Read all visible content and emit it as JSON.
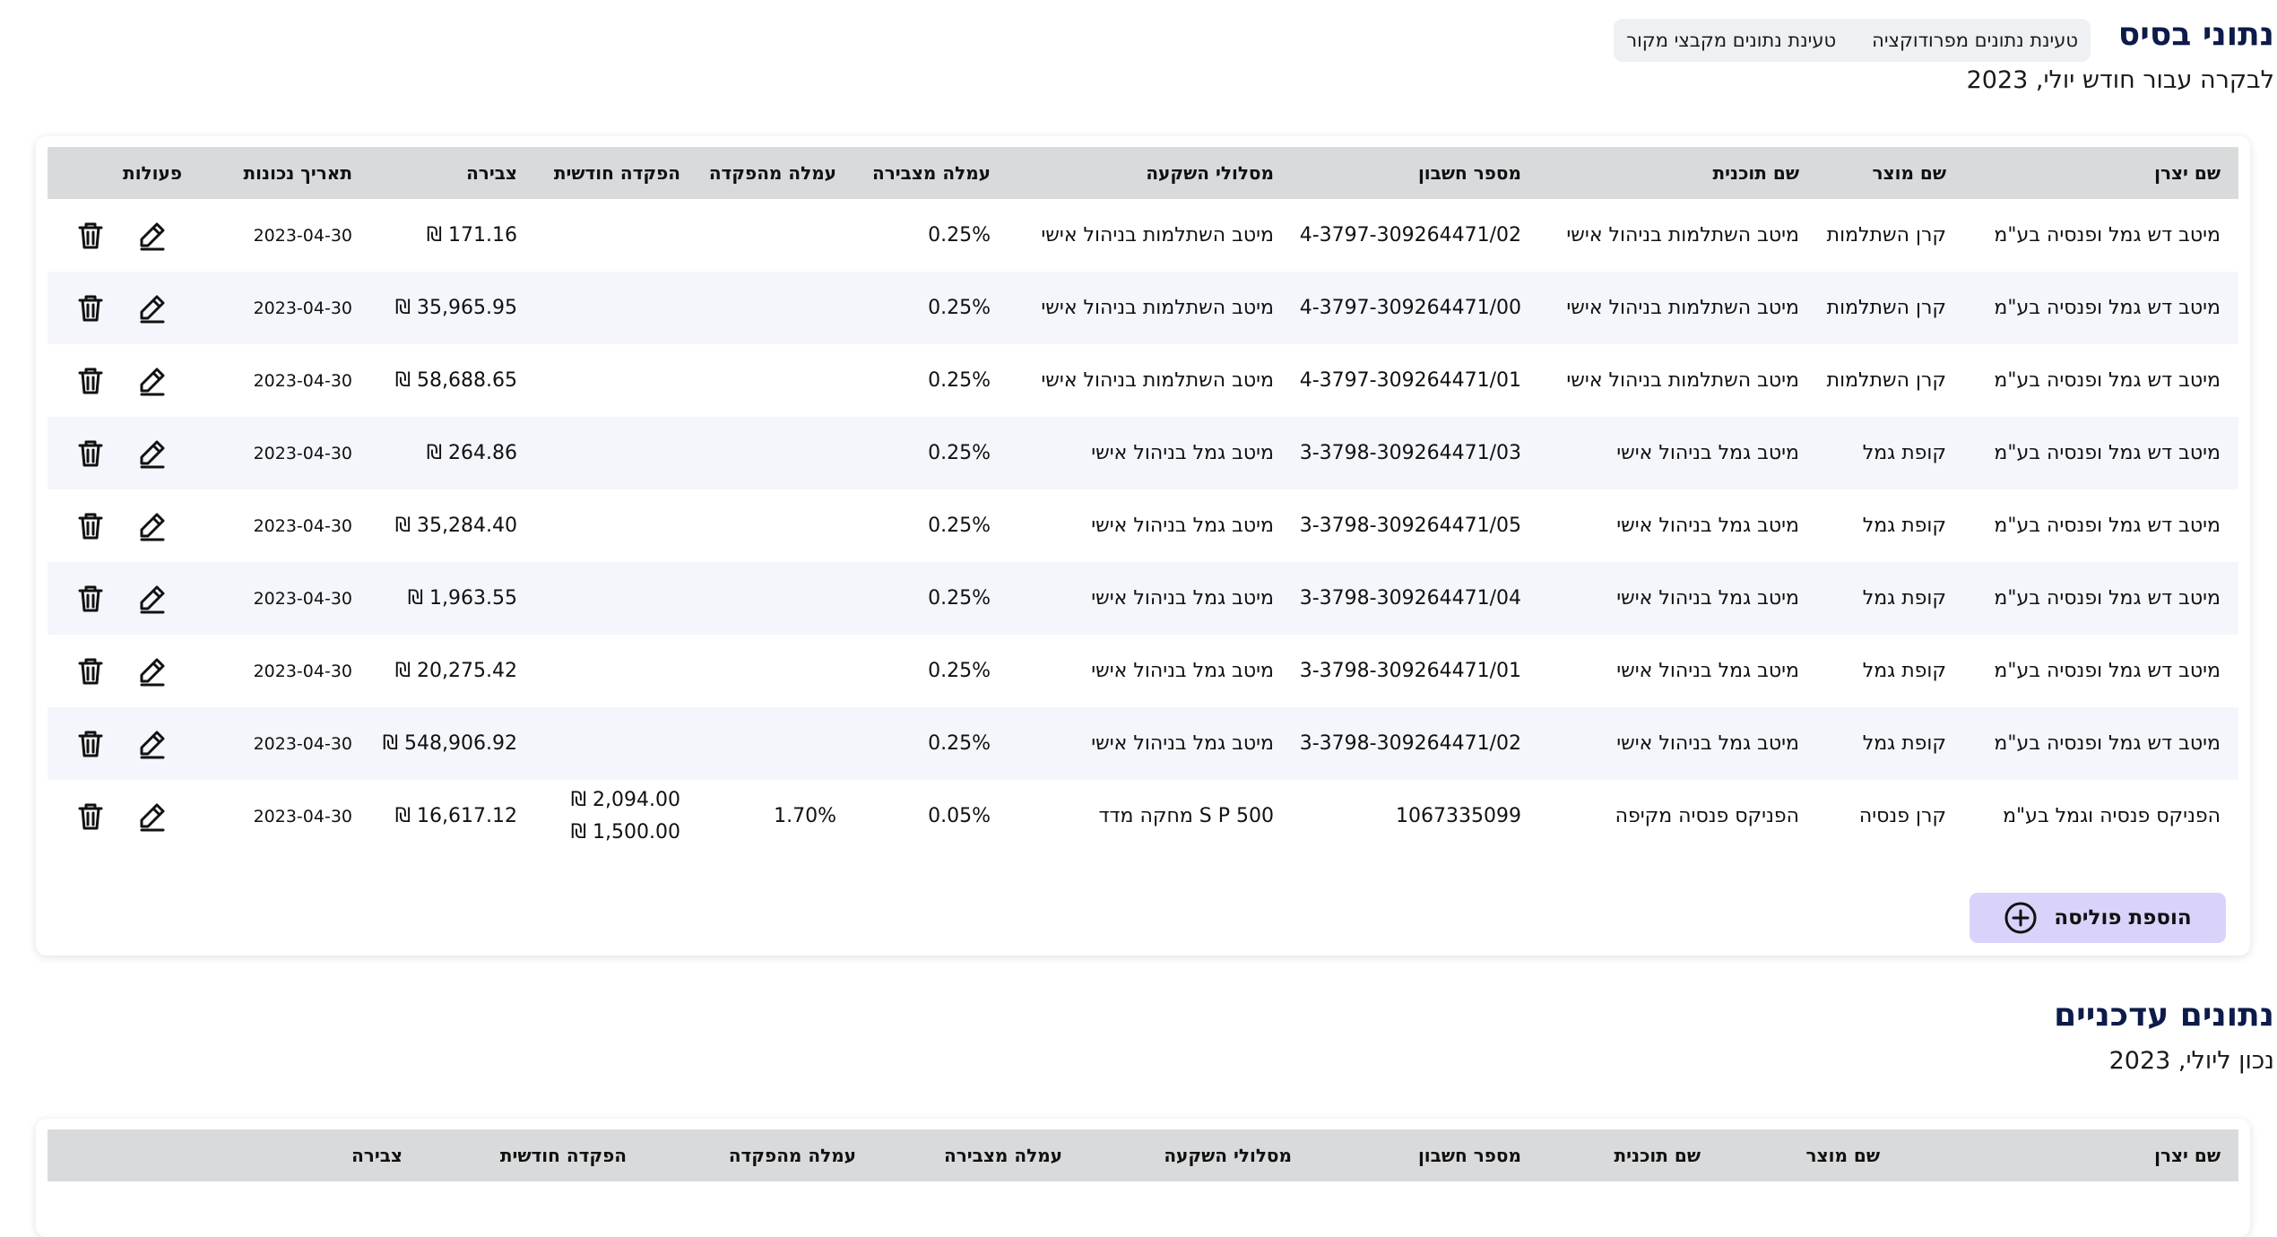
{
  "base": {
    "title": "נתוני בסיס",
    "subtitle": "לבקרה עבור חודש יולי, 2023",
    "loaders": [
      "טעינת נתונים מפרודוקציה",
      "טעינת נתונים מקבצי מקור"
    ],
    "columns": [
      "שם יצרן",
      "שם מוצר",
      "שם תוכנית",
      "מספר חשבון",
      "מסלולי השקעה",
      "עמלה מצבירה",
      "עמלה מהפקדה",
      "הפקדה חודשית",
      "צבירה",
      "תאריך נכונות",
      "פעולות"
    ],
    "rows": [
      [
        "מיטב דש גמל ופנסיה בע\"מ",
        "קרן השתלמות",
        "מיטב השתלמות בניהול אישי",
        "4-3797-309264471/02",
        "מיטב השתלמות בניהול אישי",
        "0.25%",
        "",
        "",
        "171.16 ₪",
        "2023-04-30"
      ],
      [
        "מיטב דש גמל ופנסיה בע\"מ",
        "קרן השתלמות",
        "מיטב השתלמות בניהול אישי",
        "4-3797-309264471/00",
        "מיטב השתלמות בניהול אישי",
        "0.25%",
        "",
        "",
        "35,965.95 ₪",
        "2023-04-30"
      ],
      [
        "מיטב דש גמל ופנסיה בע\"מ",
        "קרן השתלמות",
        "מיטב השתלמות בניהול אישי",
        "4-3797-309264471/01",
        "מיטב השתלמות בניהול אישי",
        "0.25%",
        "",
        "",
        "58,688.65 ₪",
        "2023-04-30"
      ],
      [
        "מיטב דש גמל ופנסיה בע\"מ",
        "קופת גמל",
        "מיטב גמל בניהול אישי",
        "3-3798-309264471/03",
        "מיטב גמל בניהול אישי",
        "0.25%",
        "",
        "",
        "264.86 ₪",
        "2023-04-30"
      ],
      [
        "מיטב דש גמל ופנסיה בע\"מ",
        "קופת גמל",
        "מיטב גמל בניהול אישי",
        "3-3798-309264471/05",
        "מיטב גמל בניהול אישי",
        "0.25%",
        "",
        "",
        "35,284.40 ₪",
        "2023-04-30"
      ],
      [
        "מיטב דש גמל ופנסיה בע\"מ",
        "קופת גמל",
        "מיטב גמל בניהול אישי",
        "3-3798-309264471/04",
        "מיטב גמל בניהול אישי",
        "0.25%",
        "",
        "",
        "1,963.55 ₪",
        "2023-04-30"
      ],
      [
        "מיטב דש גמל ופנסיה בע\"מ",
        "קופת גמל",
        "מיטב גמל בניהול אישי",
        "3-3798-309264471/01",
        "מיטב גמל בניהול אישי",
        "0.25%",
        "",
        "",
        "20,275.42 ₪",
        "2023-04-30"
      ],
      [
        "מיטב דש גמל ופנסיה בע\"מ",
        "קופת גמל",
        "מיטב גמל בניהול אישי",
        "3-3798-309264471/02",
        "מיטב גמל בניהול אישי",
        "0.25%",
        "",
        "",
        "548,906.92 ₪",
        "2023-04-30"
      ],
      [
        "הפניקס פנסיה וגמל בע\"מ",
        "קרן פנסיה",
        "הפניקס פנסיה מקיפה",
        "1067335099",
        "S P 500 מחקה מדד",
        "0.05%",
        "1.70%",
        "2,094.00 ₪\n1,500.00 ₪",
        "16,617.12 ₪",
        "2023-04-30"
      ]
    ],
    "add_button": "הוספת פוליסה"
  },
  "current": {
    "title": "נתונים עדכניים",
    "subtitle": "נכון ליולי, 2023",
    "columns": [
      "שם יצרן",
      "שם מוצר",
      "שם תוכנית",
      "מספר חשבון",
      "מסלולי השקעה",
      "עמלה מצבירה",
      "עמלה מהפקדה",
      "הפקדה חודשית",
      "צבירה"
    ]
  },
  "icons": {
    "edit": "pencil-edit-icon",
    "delete": "trash-icon",
    "add": "plus-circle-icon"
  },
  "colors": {
    "title": "#0d1b4a",
    "header_bg": "#d9dadb",
    "stripe": "#f4f6fb",
    "add_btn": "#d9d3fb"
  }
}
